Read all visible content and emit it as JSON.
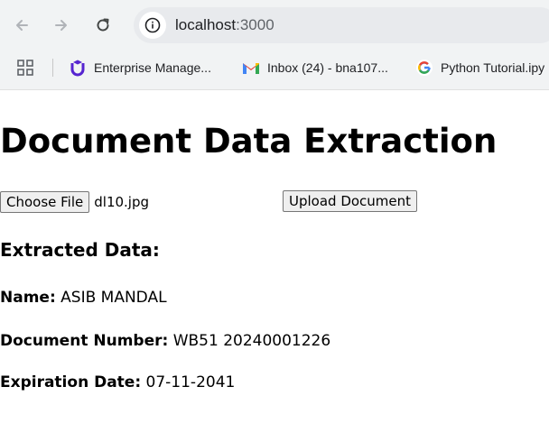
{
  "browser": {
    "url_host": "localhost",
    "url_port": ":3000",
    "bookmarks": [
      {
        "label": "Enterprise Manage...",
        "icon": "udemy-icon"
      },
      {
        "label": "Inbox (24) - bna107...",
        "icon": "gmail-icon"
      },
      {
        "label": "Python Tutorial.ipy",
        "icon": "google-icon"
      }
    ]
  },
  "page": {
    "title": "Document Data Extraction",
    "choose_file_label": "Choose File",
    "selected_file": "dl10.jpg",
    "upload_label": "Upload Document",
    "extracted_heading": "Extracted Data:",
    "fields": {
      "name": {
        "label": "Name:",
        "value": "ASIB MANDAL"
      },
      "document_number": {
        "label": "Document Number:",
        "value": "WB51 20240001226"
      },
      "expiration_date": {
        "label": "Expiration Date:",
        "value": "07-11-2041"
      }
    }
  },
  "colors": {
    "chrome_bg": "#f1f3f4",
    "omnibox_bg": "#e8eaed",
    "udemy_purple": "#5624d0",
    "gmail_red": "#ea4335"
  }
}
